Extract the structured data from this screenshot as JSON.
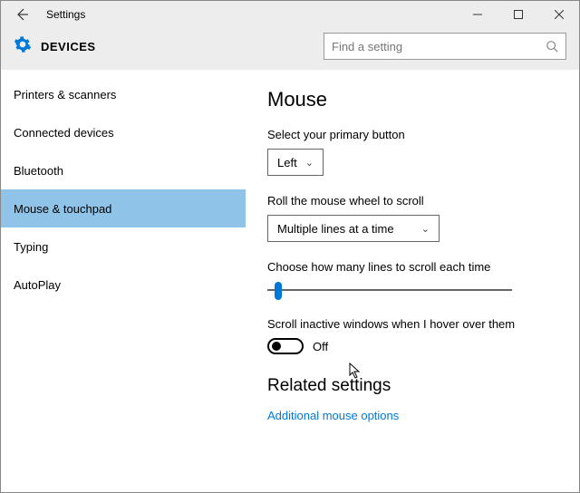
{
  "window": {
    "title": "Settings"
  },
  "header": {
    "section": "DEVICES",
    "search_placeholder": "Find a setting"
  },
  "sidebar": {
    "items": [
      {
        "label": "Printers & scanners"
      },
      {
        "label": "Connected devices"
      },
      {
        "label": "Bluetooth"
      },
      {
        "label": "Mouse & touchpad"
      },
      {
        "label": "Typing"
      },
      {
        "label": "AutoPlay"
      }
    ],
    "active_index": 3
  },
  "main": {
    "heading": "Mouse",
    "primary_button_label": "Select your primary button",
    "primary_button_value": "Left",
    "wheel_label": "Roll the mouse wheel to scroll",
    "wheel_value": "Multiple lines at a time",
    "lines_label": "Choose how many lines to scroll each time",
    "hover_label": "Scroll inactive windows when I hover over them",
    "hover_value": "Off",
    "related_heading": "Related settings",
    "related_link": "Additional mouse options"
  }
}
